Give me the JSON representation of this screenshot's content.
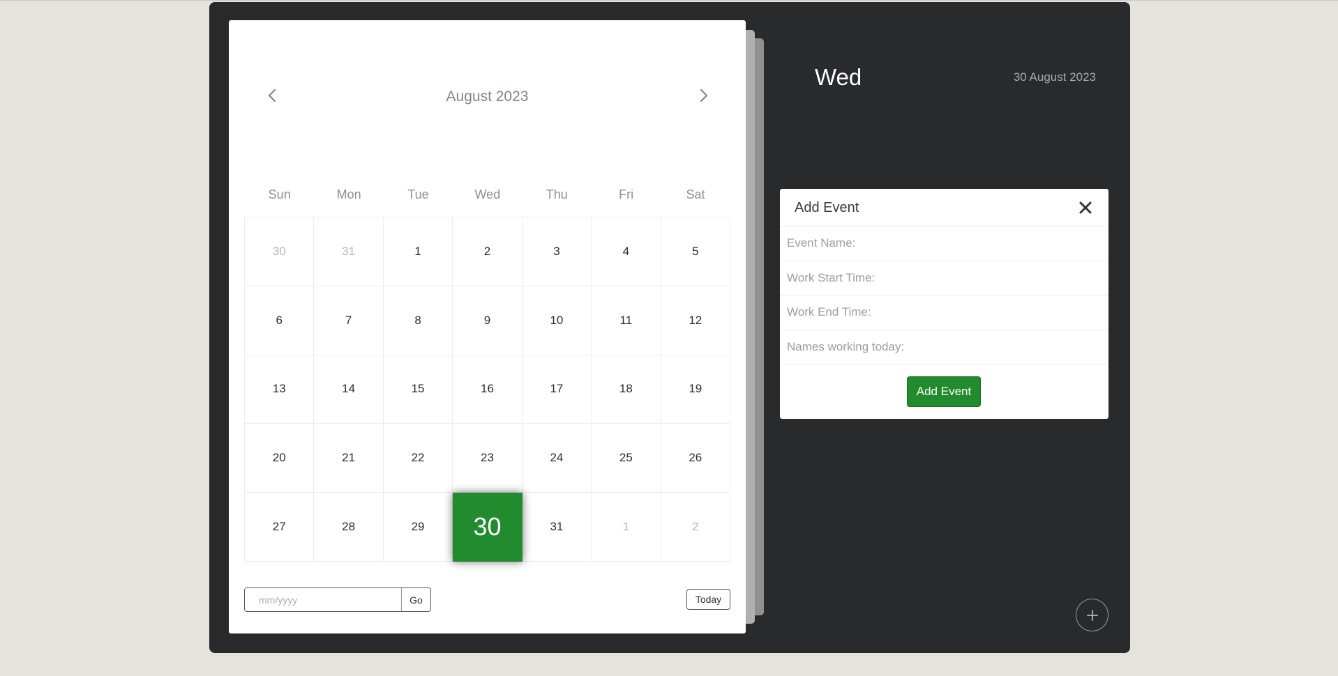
{
  "calendar": {
    "month_title": "August 2023",
    "weekdays": [
      "Sun",
      "Mon",
      "Tue",
      "Wed",
      "Thu",
      "Fri",
      "Sat"
    ],
    "weeks": [
      [
        {
          "n": "30",
          "other": true
        },
        {
          "n": "31",
          "other": true
        },
        {
          "n": "1"
        },
        {
          "n": "2"
        },
        {
          "n": "3"
        },
        {
          "n": "4"
        },
        {
          "n": "5"
        }
      ],
      [
        {
          "n": "6"
        },
        {
          "n": "7"
        },
        {
          "n": "8"
        },
        {
          "n": "9"
        },
        {
          "n": "10"
        },
        {
          "n": "11"
        },
        {
          "n": "12"
        }
      ],
      [
        {
          "n": "13"
        },
        {
          "n": "14"
        },
        {
          "n": "15"
        },
        {
          "n": "16"
        },
        {
          "n": "17"
        },
        {
          "n": "18"
        },
        {
          "n": "19"
        }
      ],
      [
        {
          "n": "20"
        },
        {
          "n": "21"
        },
        {
          "n": "22"
        },
        {
          "n": "23"
        },
        {
          "n": "24"
        },
        {
          "n": "25"
        },
        {
          "n": "26"
        }
      ],
      [
        {
          "n": "27"
        },
        {
          "n": "28"
        },
        {
          "n": "29"
        },
        {
          "n": "30",
          "active": true
        },
        {
          "n": "31"
        },
        {
          "n": "1",
          "other": true
        },
        {
          "n": "2",
          "other": true
        }
      ]
    ],
    "goto_placeholder": "mm/yyyy",
    "go_label": "Go",
    "today_label": "Today"
  },
  "selected": {
    "day_name": "Wed",
    "date_text": "30 August 2023"
  },
  "add_event": {
    "title": "Add Event",
    "fields": [
      {
        "placeholder": "Event Name:"
      },
      {
        "placeholder": "Work Start Time:"
      },
      {
        "placeholder": "Work End Time:"
      },
      {
        "placeholder": "Names working today:"
      }
    ],
    "submit_label": "Add Event"
  },
  "icons": {
    "prev": "chevron-left-icon",
    "next": "chevron-right-icon",
    "close": "close-icon",
    "fab": "plus-icon"
  },
  "colors": {
    "active_day": "#228b2e",
    "panel_bg": "#292a2c",
    "page_bg": "#e4e3de"
  }
}
